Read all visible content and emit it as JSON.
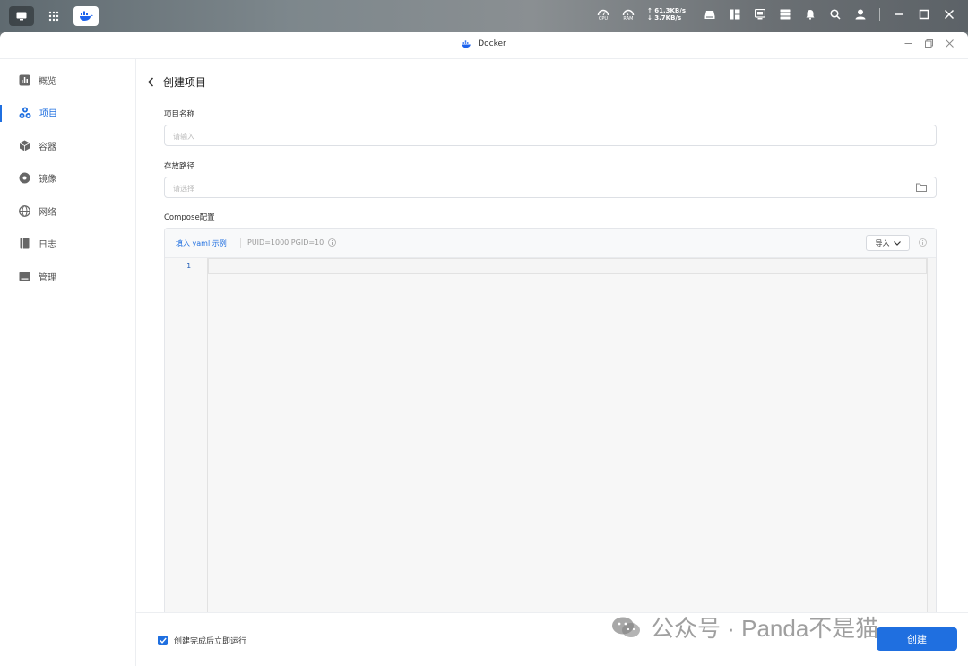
{
  "desktop": {
    "cpu_label": "CPU",
    "ram_label": "RAM",
    "upload_rate": "↑ 61.3KB/s",
    "download_rate": "↓ 3.7KB/s"
  },
  "window": {
    "title": "Docker"
  },
  "sidebar": {
    "items": [
      {
        "label": "概览",
        "icon": "chart-icon"
      },
      {
        "label": "项目",
        "icon": "project-icon"
      },
      {
        "label": "容器",
        "icon": "container-icon"
      },
      {
        "label": "镜像",
        "icon": "image-icon"
      },
      {
        "label": "网络",
        "icon": "globe-icon"
      },
      {
        "label": "日志",
        "icon": "log-icon"
      },
      {
        "label": "管理",
        "icon": "manage-icon"
      }
    ],
    "active_index": 1
  },
  "page": {
    "title": "创建项目",
    "project_name_label": "项目名称",
    "project_name_placeholder": "请输入",
    "path_label": "存放路径",
    "path_placeholder": "请选择",
    "compose_label": "Compose配置"
  },
  "editor": {
    "fill_example_link": "填入 yaml 示例",
    "env_hint": "PUID=1000 PGID=10",
    "import_label": "导入",
    "line_number": "1",
    "content": ""
  },
  "footer": {
    "run_after_create_label": "创建完成后立即运行",
    "run_after_create_checked": true,
    "create_label": "创建"
  },
  "watermark": {
    "text": "公众号 · Panda不是猫"
  },
  "colors": {
    "accent": "#1f6fe0"
  }
}
